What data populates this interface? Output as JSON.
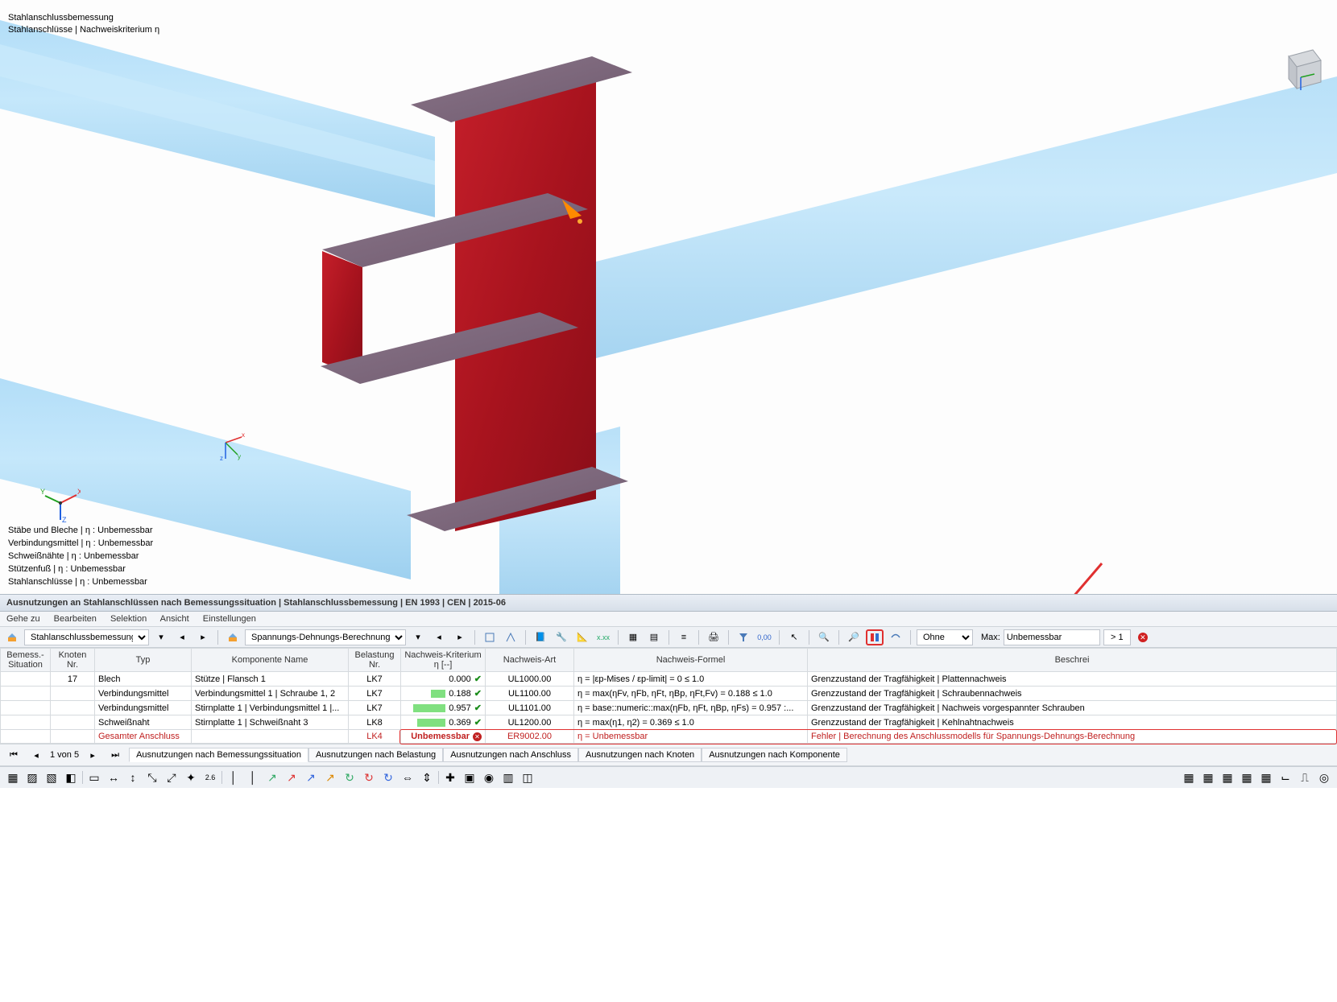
{
  "viewport": {
    "top_labels": [
      "Stahlanschlussbemessung",
      "Stahlanschlüsse | Nachweiskriterium η"
    ],
    "status_labels": [
      "Stäbe und Bleche | η : Unbemessbar",
      "Verbindungsmittel | η : Unbemessbar",
      "Schweißnähte | η : Unbemessbar",
      "Stützenfuß | η : Unbemessbar",
      "Stahlanschlüsse | η : Unbemessbar"
    ]
  },
  "panel": {
    "title": "Ausnutzungen an Stahlanschlüssen nach Bemessungssituation | Stahlanschlussbemessung | EN 1993 | CEN | 2015-06",
    "menu": [
      "Gehe zu",
      "Bearbeiten",
      "Selektion",
      "Ansicht",
      "Einstellungen"
    ],
    "toolbar": {
      "combo1": "Stahlanschlussbemessung",
      "combo2": "Spannungs-Dehnungs-Berechnung",
      "filter": "Ohne",
      "max_label": "Max:",
      "max_value": "Unbemessbar",
      "max_threshold": "> 1"
    },
    "columns": [
      "Bemess.-Situation",
      "Knoten Nr.",
      "Typ",
      "Komponente Name",
      "Belastung Nr.",
      "Nachweis-Kriterium η [--]",
      "Nachweis-Art",
      "Nachweis-Formel",
      "Beschrei"
    ],
    "rows": [
      {
        "sit": "",
        "knoten": "17",
        "typ": "Blech",
        "name": "Stütze | Flansch 1",
        "bel": "LK7",
        "eta": "0.000",
        "etabar": 0,
        "ok": true,
        "art": "UL1000.00",
        "formel": "η = |εp-Mises / εp-limit| = 0 ≤ 1.0",
        "beschr": "Grenzzustand der Tragfähigkeit | Plattennachweis"
      },
      {
        "sit": "",
        "knoten": "",
        "typ": "Verbindungsmittel",
        "name": "Verbindungsmittel 1 | Schraube 1, 2",
        "bel": "LK7",
        "eta": "0.188",
        "etabar": 19,
        "ok": true,
        "art": "UL1100.00",
        "formel": "η = max(ηFv, ηFb, ηFt, ηBp, ηFt,Fv) = 0.188 ≤ 1.0",
        "beschr": "Grenzzustand der Tragfähigkeit | Schraubennachweis"
      },
      {
        "sit": "",
        "knoten": "",
        "typ": "Verbindungsmittel",
        "name": "Stirnplatte 1 | Verbindungsmittel 1 |...",
        "bel": "LK7",
        "eta": "0.957",
        "etabar": 96,
        "ok": true,
        "art": "UL1101.00",
        "formel": "η = base::numeric::max(ηFb, ηFt, ηBp, ηFs) = 0.957 :...",
        "beschr": "Grenzzustand der Tragfähigkeit | Nachweis vorgespannter Schrauben"
      },
      {
        "sit": "",
        "knoten": "",
        "typ": "Schweißnaht",
        "name": "Stirnplatte 1 | Schweißnaht 3",
        "bel": "LK8",
        "eta": "0.369",
        "etabar": 37,
        "ok": true,
        "art": "UL1200.00",
        "formel": "η = max(η1, η2) = 0.369 ≤ 1.0",
        "beschr": "Grenzzustand der Tragfähigkeit | Kehlnahtnachweis"
      },
      {
        "sit": "",
        "knoten": "",
        "typ": "Gesamter Anschluss",
        "name": "",
        "bel": "LK4",
        "eta": "Unbemessbar",
        "etabar": null,
        "ok": false,
        "art": "ER9002.00",
        "formel": "η = Unbemessbar",
        "beschr": "Fehler | Berechnung des Anschlussmodells für Spannungs-Dehnungs-Berechnung"
      }
    ],
    "pager": {
      "pos": "1 von 5",
      "tabs": [
        "Ausnutzungen nach Bemessungssituation",
        "Ausnutzungen nach Belastung",
        "Ausnutzungen nach Anschluss",
        "Ausnutzungen nach Knoten",
        "Ausnutzungen nach Komponente"
      ],
      "active": 0
    }
  }
}
